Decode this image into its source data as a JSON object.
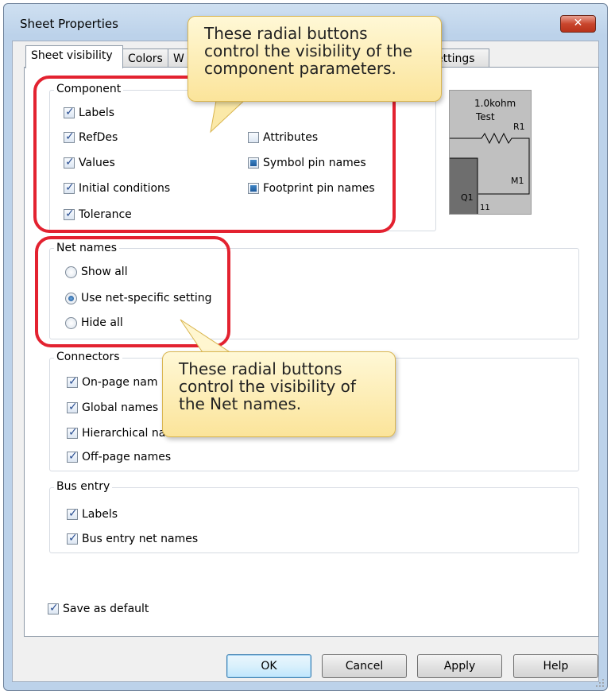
{
  "window": {
    "title": "Sheet Properties",
    "close_glyph": "✕"
  },
  "tabs": [
    "Sheet visibility",
    "Colors",
    "W",
    "Settings"
  ],
  "tab_partial_right": "ettings",
  "component": {
    "title": "Component",
    "left_items": [
      {
        "label": "Labels",
        "checked": true
      },
      {
        "label": "RefDes",
        "checked": true
      },
      {
        "label": "Values",
        "checked": true
      },
      {
        "label": "Initial conditions",
        "checked": true
      },
      {
        "label": "Tolerance",
        "checked": true
      }
    ],
    "right_items": [
      {
        "label": "Attributes",
        "state": "unchecked"
      },
      {
        "label": "Symbol pin names",
        "state": "indeterminate"
      },
      {
        "label": "Footprint pin names",
        "state": "indeterminate"
      }
    ]
  },
  "preview": {
    "value": "1.0kohm",
    "test": "Test",
    "r1": "R1",
    "m1": "M1",
    "q1": "Q1",
    "pin": "11"
  },
  "net_names": {
    "title": "Net names",
    "options": [
      "Show all",
      "Use net-specific setting",
      "Hide all"
    ],
    "selected": 1
  },
  "connectors": {
    "title": "Connectors",
    "items": [
      "On-page nam",
      "Global names",
      "Hierarchical nam",
      "Off-page names"
    ]
  },
  "bus_entry": {
    "title": "Bus entry",
    "items": [
      "Labels",
      "Bus entry net names"
    ]
  },
  "save_default": "Save as default",
  "buttons": {
    "ok": "OK",
    "cancel": "Cancel",
    "apply": "Apply",
    "help": "Help"
  },
  "callouts": {
    "top": "These radial buttons control the visibility of the component parameters.",
    "bottom": "These radial buttons control the visibility of the Net names."
  },
  "colors": {
    "highlight": "#e32230",
    "callout_fill": "#fbe49a"
  }
}
